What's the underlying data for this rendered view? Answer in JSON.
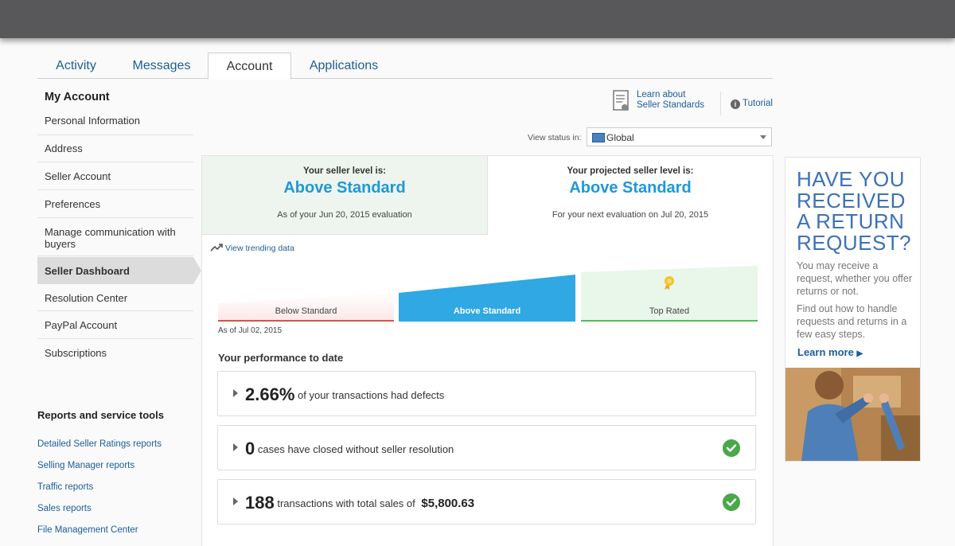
{
  "tabs": [
    {
      "label": "Activity"
    },
    {
      "label": "Messages"
    },
    {
      "label": "Account"
    },
    {
      "label": "Applications"
    }
  ],
  "sidebar": {
    "title": "My Account",
    "items": [
      {
        "label": "Personal Information"
      },
      {
        "label": "Address"
      },
      {
        "label": "Seller Account"
      },
      {
        "label": "Preferences"
      },
      {
        "label": "Manage communication with buyers"
      },
      {
        "label": "Seller Dashboard"
      },
      {
        "label": "Resolution Center"
      },
      {
        "label": "PayPal Account"
      },
      {
        "label": "Subscriptions"
      }
    ],
    "reports_title": "Reports and service tools",
    "reports": [
      {
        "label": "Detailed Seller Ratings reports"
      },
      {
        "label": "Selling Manager reports"
      },
      {
        "label": "Traffic reports"
      },
      {
        "label": "Sales reports"
      },
      {
        "label": "File Management Center"
      }
    ]
  },
  "header": {
    "learn_line1": "Learn about",
    "learn_line2": "Seller Standards",
    "tutorial": "Tutorial",
    "view_status_label": "View status in:",
    "view_status_value": "Global"
  },
  "level": {
    "current_label": "Your seller level is:",
    "current_value": "Above Standard",
    "current_sub": "As of your Jun 20, 2015 evaluation",
    "projected_label": "Your projected seller level is:",
    "projected_value": "Above Standard",
    "projected_sub": "For your next evaluation on Jul 20, 2015"
  },
  "trending_link": "View trending data",
  "scale": {
    "below": "Below Standard",
    "above": "Above Standard",
    "top": "Top Rated",
    "as_of": "As of Jul 02, 2015"
  },
  "performance": {
    "title": "Your performance to date",
    "defects_value": "2.66%",
    "defects_text": "of your transactions had defects",
    "cases_value": "0",
    "cases_text": "cases have closed without seller resolution",
    "transactions_value": "188",
    "transactions_text": "transactions with total sales of",
    "sales_value": "$5,800.63"
  },
  "ad": {
    "headline": "HAVE YOU RECEIVED A RETURN REQUEST?",
    "p1": "You may receive a request, whether you offer returns or not.",
    "p2": "Find out how to handle requests and returns in a few easy steps.",
    "learn_more": "Learn more"
  },
  "colors": {
    "accent_blue": "#1e98d8",
    "link_blue": "#1d5d98",
    "check_green": "#4aa84a",
    "below_red": "#d9534f",
    "top_green": "#5cb85c"
  }
}
